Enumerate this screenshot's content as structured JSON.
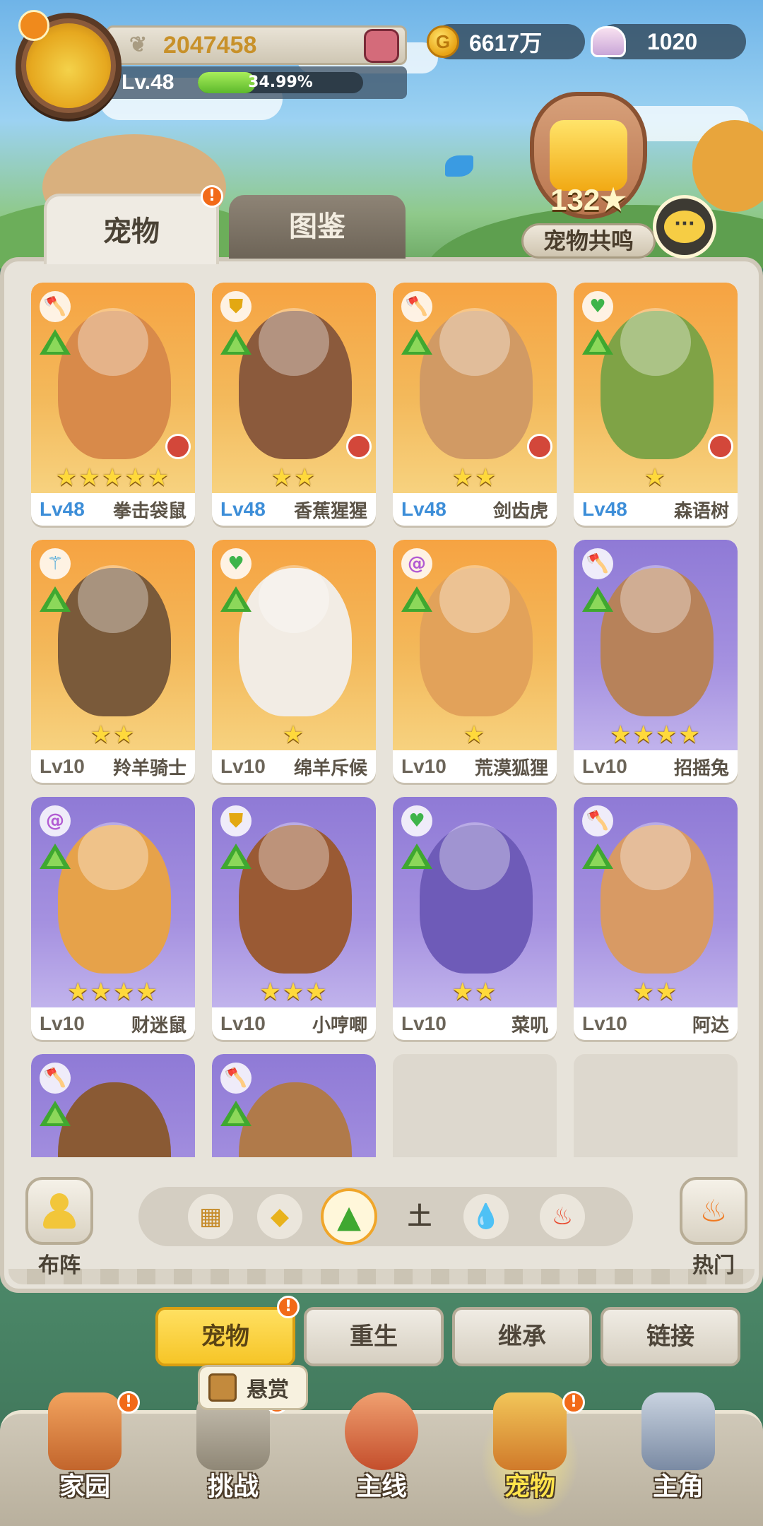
{
  "player": {
    "power": "2047458",
    "level": "Lv.48",
    "xp_percent_text": "34.99%",
    "xp_fraction": 0.3499
  },
  "currency": {
    "gold": "6617万",
    "shells": "1020"
  },
  "resonance": {
    "count": "132★",
    "label": "宠物共鸣"
  },
  "tabs": {
    "pets": "宠物",
    "codex": "图鉴",
    "pets_badge": "!"
  },
  "cards": [
    {
      "level": "Lv48",
      "name": "拳击袋鼠",
      "stars": "★★★★★",
      "element": "axe",
      "bg": "orange"
    },
    {
      "level": "Lv48",
      "name": "香蕉猩猩",
      "stars": "★★",
      "element": "shield",
      "bg": "orange"
    },
    {
      "level": "Lv48",
      "name": "剑齿虎",
      "stars": "★★",
      "element": "axe",
      "bg": "orange"
    },
    {
      "level": "Lv48",
      "name": "森语树",
      "stars": "★",
      "element": "heart",
      "bg": "orange"
    },
    {
      "level": "Lv10",
      "name": "羚羊骑士",
      "stars": "★★",
      "element": "staff",
      "bg": "orange"
    },
    {
      "level": "Lv10",
      "name": "绵羊斥候",
      "stars": "★",
      "element": "heart",
      "bg": "orange"
    },
    {
      "level": "Lv10",
      "name": "荒漠狐狸",
      "stars": "★",
      "element": "swirl",
      "bg": "orange"
    },
    {
      "level": "Lv10",
      "name": "招摇兔",
      "stars": "★★★★",
      "element": "axe",
      "bg": "purple"
    },
    {
      "level": "Lv10",
      "name": "财迷鼠",
      "stars": "★★★★",
      "element": "swirl",
      "bg": "purple"
    },
    {
      "level": "Lv10",
      "name": "小哼唧",
      "stars": "★★★",
      "element": "shield",
      "bg": "purple"
    },
    {
      "level": "Lv10",
      "name": "菜叽",
      "stars": "★★",
      "element": "heart",
      "bg": "purple"
    },
    {
      "level": "Lv10",
      "name": "阿达",
      "stars": "★★",
      "element": "axe",
      "bg": "purple"
    }
  ],
  "filters": {
    "formation_label": "布阵",
    "earth_label": "土",
    "hot_label": "热门"
  },
  "subtabs": {
    "pets": "宠物",
    "rebirth": "重生",
    "inherit": "继承",
    "link": "链接",
    "badge": "!"
  },
  "bounty": {
    "label": "悬赏"
  },
  "bottom_nav": {
    "home": "家园",
    "challenge": "挑战",
    "main": "主线",
    "pets": "宠物",
    "hero": "主角",
    "badge": "!"
  },
  "colors": {
    "accent_yellow": "#f6c527",
    "xp_green": "#5cb92c",
    "level_blue": "#3d8ed8",
    "notification_orange": "#f26a18"
  }
}
